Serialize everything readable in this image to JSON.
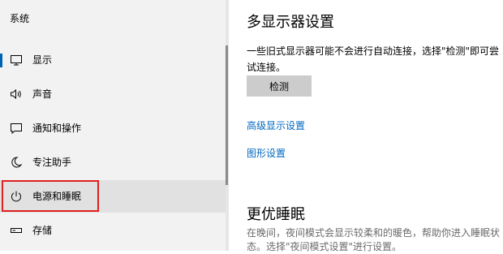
{
  "sidebar": {
    "section_title": "系统",
    "items": [
      {
        "label": "显示",
        "icon": "monitor-icon"
      },
      {
        "label": "声音",
        "icon": "speaker-icon"
      },
      {
        "label": "通知和操作",
        "icon": "message-icon"
      },
      {
        "label": "专注助手",
        "icon": "moon-icon"
      },
      {
        "label": "电源和睡眠",
        "icon": "power-icon"
      },
      {
        "label": "存储",
        "icon": "storage-icon"
      }
    ]
  },
  "main": {
    "multi_display_title": "多显示器设置",
    "multi_display_desc": "一些旧式显示器可能不会进行自动连接，选择\"检测\"即可尝试连接。",
    "detect_button": "检测",
    "advanced_display_link": "高级显示设置",
    "graphics_settings_link": "图形设置",
    "sleep_title": "更优睡眠",
    "sleep_desc": "在晚间，夜间模式会显示较柔和的暖色，帮助你进入睡眠状态。选择\"夜间模式设置\"进行设置。"
  },
  "colors": {
    "accent": "#0063b1",
    "link": "#0067c0",
    "highlight_border": "#e02020"
  }
}
